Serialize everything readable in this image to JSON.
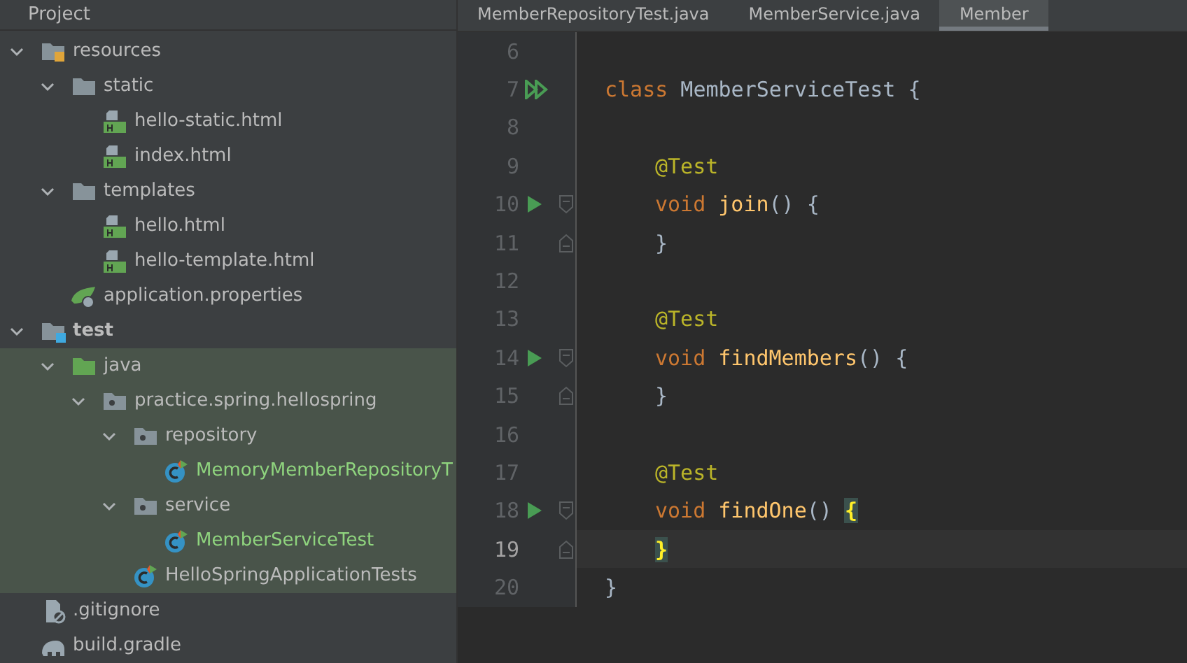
{
  "project_header": {
    "title": "Project"
  },
  "tabs": [
    {
      "label": "MemberRepositoryTest.java",
      "selected": false
    },
    {
      "label": "MemberService.java",
      "selected": false
    },
    {
      "label": "Member",
      "selected": true
    }
  ],
  "tree": [
    {
      "label": "resources",
      "kind": "resources-folder",
      "expanded": true,
      "test_scope": false,
      "modified": false,
      "children": [
        {
          "label": "static",
          "kind": "folder",
          "expanded": true,
          "test_scope": false,
          "modified": false,
          "children": [
            {
              "label": "hello-static.html",
              "kind": "html",
              "test_scope": false,
              "modified": false
            },
            {
              "label": "index.html",
              "kind": "html",
              "test_scope": false,
              "modified": false
            }
          ]
        },
        {
          "label": "templates",
          "kind": "folder",
          "expanded": true,
          "test_scope": false,
          "modified": false,
          "children": [
            {
              "label": "hello.html",
              "kind": "html",
              "test_scope": false,
              "modified": false
            },
            {
              "label": "hello-template.html",
              "kind": "html",
              "test_scope": false,
              "modified": false
            }
          ]
        },
        {
          "label": "application.properties",
          "kind": "properties",
          "test_scope": false,
          "modified": false
        }
      ]
    },
    {
      "label": "test",
      "kind": "test-folder",
      "expanded": true,
      "bold": true,
      "test_scope": false,
      "modified": false,
      "children": [
        {
          "label": "java",
          "kind": "source-folder",
          "expanded": true,
          "test_scope": true,
          "modified": false,
          "children": [
            {
              "label": "practice.spring.hellospring",
              "kind": "package",
              "expanded": true,
              "test_scope": true,
              "modified": false,
              "children": [
                {
                  "label": "repository",
                  "kind": "package",
                  "expanded": true,
                  "test_scope": true,
                  "modified": false,
                  "children": [
                    {
                      "label": "MemoryMemberRepositoryT",
                      "kind": "test-class",
                      "test_scope": true,
                      "modified": true
                    }
                  ]
                },
                {
                  "label": "service",
                  "kind": "package",
                  "expanded": true,
                  "test_scope": true,
                  "modified": false,
                  "children": [
                    {
                      "label": "MemberServiceTest",
                      "kind": "test-class",
                      "test_scope": true,
                      "modified": true
                    }
                  ]
                },
                {
                  "label": "HelloSpringApplicationTests",
                  "kind": "test-class",
                  "test_scope": true,
                  "modified": false
                }
              ]
            }
          ]
        }
      ]
    },
    {
      "label": ".gitignore",
      "kind": "ignore-file",
      "test_scope": false,
      "modified": false
    },
    {
      "label": "build.gradle",
      "kind": "gradle",
      "test_scope": false,
      "modified": false
    }
  ],
  "editor": {
    "lines": [
      {
        "number": "6",
        "run": false,
        "run_all": false,
        "fold_start": false,
        "fold_end": false,
        "current": false
      },
      {
        "number": "7",
        "run": false,
        "run_all": true,
        "fold_start": false,
        "fold_end": false,
        "current": false,
        "indent": false,
        "tokens": [
          {
            "text": "class",
            "kind": "keyword"
          },
          {
            "text": " MemberServiceTest {",
            "kind": "plain"
          }
        ]
      },
      {
        "number": "8",
        "run": false,
        "run_all": false,
        "fold_start": false,
        "fold_end": false,
        "current": false
      },
      {
        "number": "9",
        "run": false,
        "run_all": false,
        "fold_start": false,
        "fold_end": false,
        "current": false,
        "indent": true,
        "tokens": [
          {
            "text": "@Test",
            "kind": "annotation"
          }
        ]
      },
      {
        "number": "10",
        "run": true,
        "run_all": false,
        "fold_start": true,
        "fold_end": false,
        "current": false,
        "indent": true,
        "tokens": [
          {
            "text": "void",
            "kind": "keyword"
          },
          {
            "text": "join",
            "kind": "method",
            "space_before": true
          },
          {
            "text": "() {",
            "kind": "plain"
          }
        ]
      },
      {
        "number": "11",
        "run": false,
        "run_all": false,
        "fold_start": false,
        "fold_end": true,
        "current": false,
        "indent": true,
        "tokens": [
          {
            "text": "}",
            "kind": "plain"
          }
        ]
      },
      {
        "number": "12",
        "run": false,
        "run_all": false,
        "fold_start": false,
        "fold_end": false,
        "current": false
      },
      {
        "number": "13",
        "run": false,
        "run_all": false,
        "fold_start": false,
        "fold_end": false,
        "current": false,
        "indent": true,
        "tokens": [
          {
            "text": "@Test",
            "kind": "annotation"
          }
        ]
      },
      {
        "number": "14",
        "run": true,
        "run_all": false,
        "fold_start": true,
        "fold_end": false,
        "current": false,
        "indent": true,
        "tokens": [
          {
            "text": "void",
            "kind": "keyword"
          },
          {
            "text": "findMembers",
            "kind": "method",
            "space_before": true
          },
          {
            "text": "() {",
            "kind": "plain"
          }
        ]
      },
      {
        "number": "15",
        "run": false,
        "run_all": false,
        "fold_start": false,
        "fold_end": true,
        "current": false,
        "indent": true,
        "tokens": [
          {
            "text": "}",
            "kind": "plain"
          }
        ]
      },
      {
        "number": "16",
        "run": false,
        "run_all": false,
        "fold_start": false,
        "fold_end": false,
        "current": false
      },
      {
        "number": "17",
        "run": false,
        "run_all": false,
        "fold_start": false,
        "fold_end": false,
        "current": false,
        "indent": true,
        "tokens": [
          {
            "text": "@Test",
            "kind": "annotation"
          }
        ]
      },
      {
        "number": "18",
        "run": true,
        "run_all": false,
        "fold_start": true,
        "fold_end": false,
        "current": false,
        "indent": true,
        "tokens": [
          {
            "text": "void",
            "kind": "keyword"
          },
          {
            "text": "findOne",
            "kind": "method",
            "space_before": true
          },
          {
            "text": "()",
            "kind": "plain"
          },
          {
            "text": "{",
            "kind": "brace-match",
            "space_before": true
          }
        ]
      },
      {
        "number": "19",
        "run": false,
        "run_all": false,
        "fold_start": false,
        "fold_end": true,
        "current": true,
        "indent": true,
        "tokens": [
          {
            "text": "}",
            "kind": "brace-match"
          }
        ]
      },
      {
        "number": "20",
        "run": false,
        "run_all": false,
        "fold_start": false,
        "fold_end": false,
        "current": false,
        "indent": false,
        "tokens": [
          {
            "text": "}",
            "kind": "plain"
          }
        ]
      }
    ]
  }
}
